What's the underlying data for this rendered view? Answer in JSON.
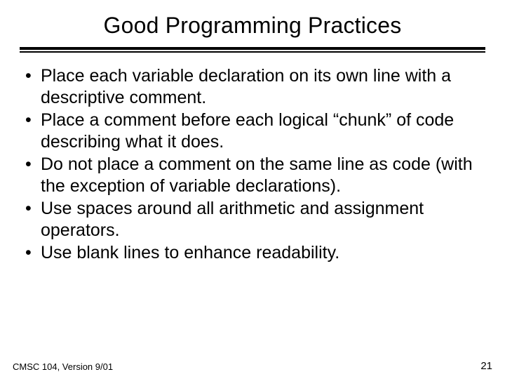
{
  "title": "Good Programming Practices",
  "bullets": [
    "Place each variable declaration on its own line with a descriptive comment.",
    "Place a comment before each logical “chunk” of code describing what it does.",
    "Do not place a comment on the same line as code (with the exception of variable declarations).",
    "Use spaces around all arithmetic and assignment operators.",
    "Use blank lines to enhance readability."
  ],
  "footer": {
    "left": "CMSC 104, Version 9/01",
    "right": "21"
  }
}
